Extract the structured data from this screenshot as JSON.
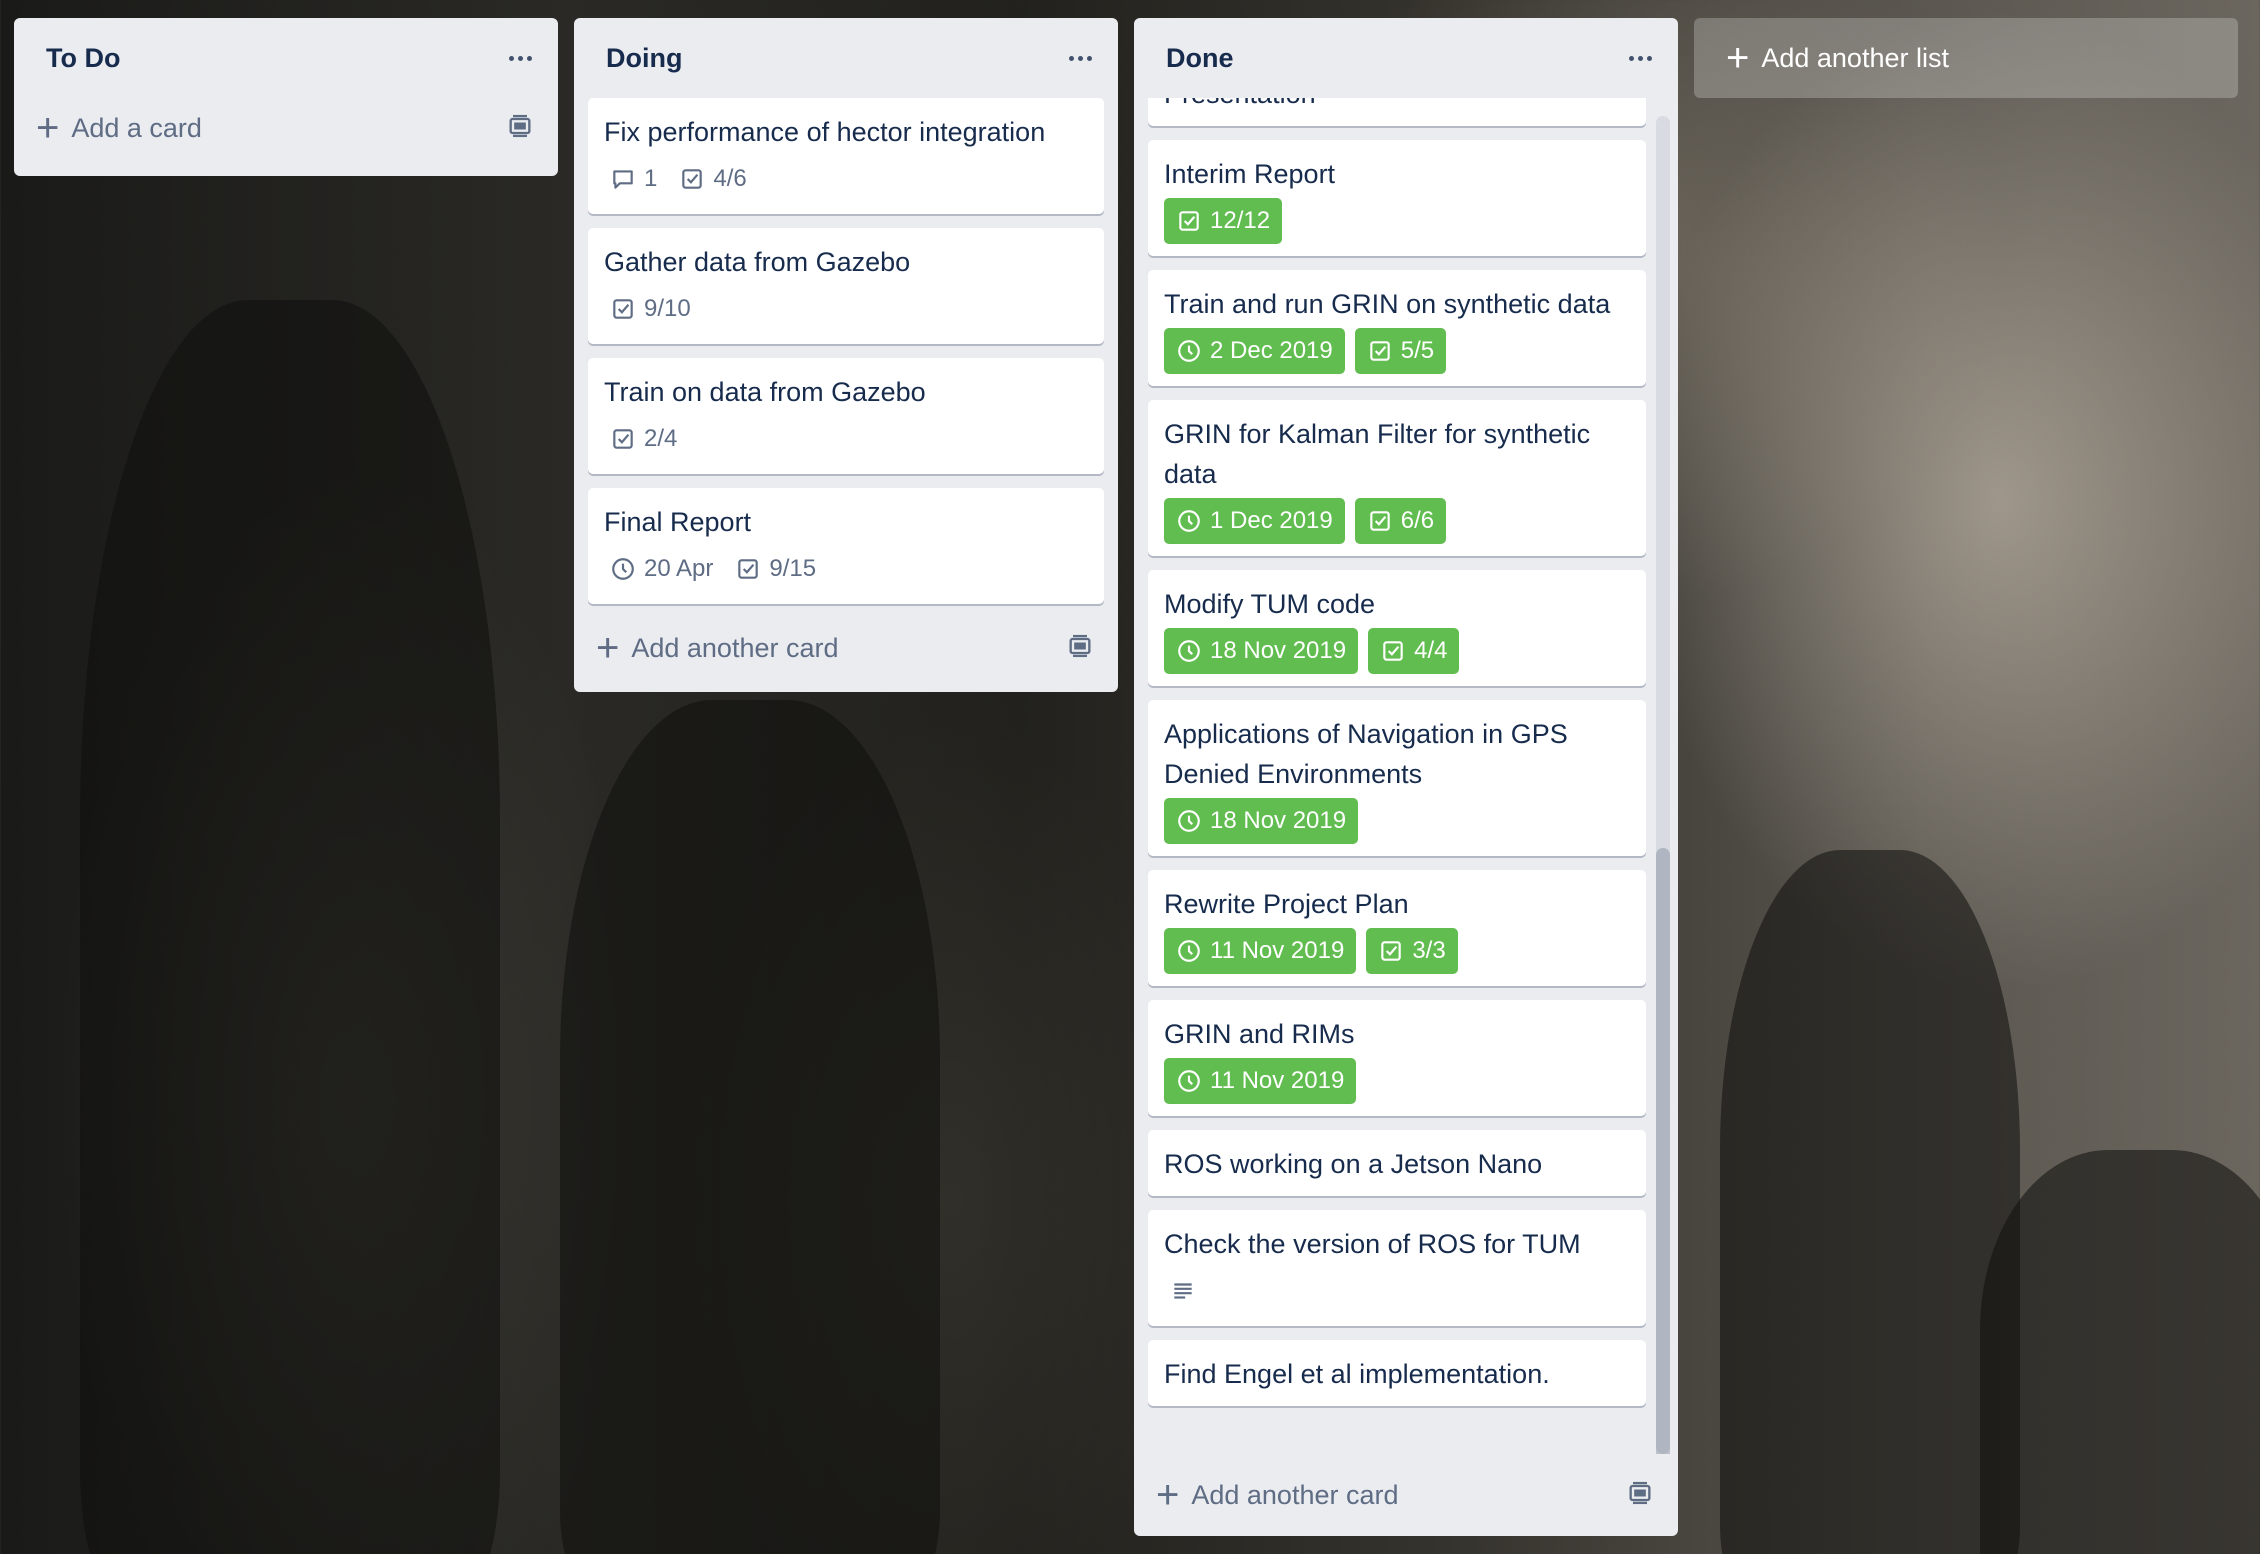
{
  "lists": {
    "todo": {
      "title": "To Do",
      "add_label": "Add a card"
    },
    "doing": {
      "title": "Doing",
      "add_label": "Add another card",
      "cards": [
        {
          "title": "Fix performance of hector integration",
          "comments": "1",
          "checklist": "4/6"
        },
        {
          "title": "Gather data from Gazebo",
          "checklist": "9/10"
        },
        {
          "title": "Train on data from Gazebo",
          "checklist": "2/4"
        },
        {
          "title": "Final Report",
          "due": "20 Apr",
          "checklist": "9/15"
        }
      ]
    },
    "done": {
      "title": "Done",
      "add_label": "Add another card",
      "cards": [
        {
          "title": "Presentation"
        },
        {
          "title": "Interim Report",
          "checklist": "12/12"
        },
        {
          "title": "Train and run GRIN on synthetic data",
          "due": "2 Dec 2019",
          "checklist": "5/5"
        },
        {
          "title": "GRIN for Kalman Filter for synthetic data",
          "due": "1 Dec 2019",
          "checklist": "6/6"
        },
        {
          "title": "Modify TUM code",
          "due": "18 Nov 2019",
          "checklist": "4/4"
        },
        {
          "title": "Applications of Navigation in GPS Denied Environments",
          "due": "18 Nov 2019"
        },
        {
          "title": "Rewrite Project Plan",
          "due": "11 Nov 2019",
          "checklist": "3/3"
        },
        {
          "title": "GRIN and RIMs",
          "due": "11 Nov 2019"
        },
        {
          "title": "ROS working on a Jetson Nano"
        },
        {
          "title": "Check the version of ROS for TUM",
          "has_description": true
        },
        {
          "title": "Find Engel et al implementation."
        }
      ]
    }
  },
  "add_list_label": "Add another list",
  "colors": {
    "list_bg": "#ebecf0",
    "badge_complete": "#61bd4f",
    "text": "#172b4d",
    "muted": "#5e6c84"
  }
}
